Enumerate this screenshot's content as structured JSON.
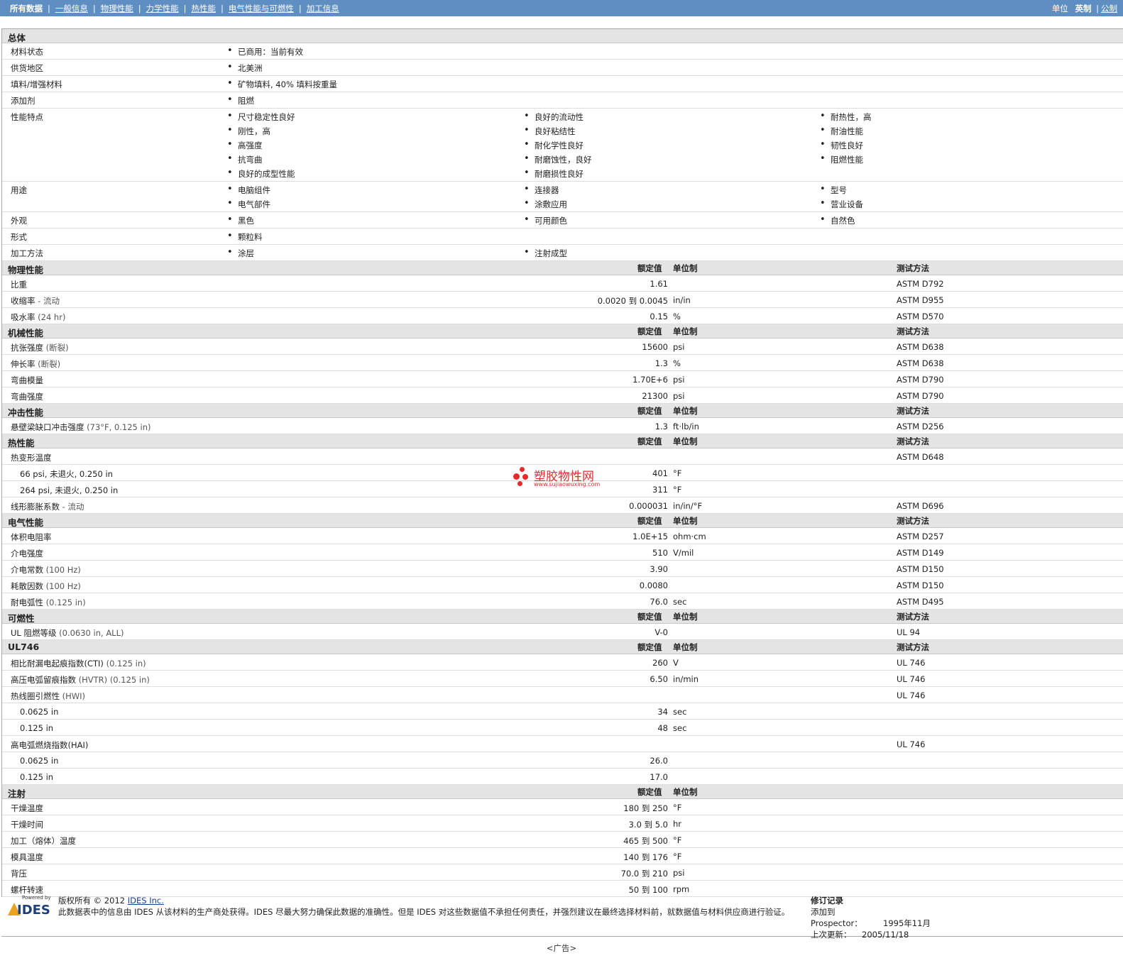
{
  "topbar": {
    "nav": [
      "所有数据",
      "一般信息",
      "物理性能",
      "力学性能",
      "热性能",
      "电气性能与可燃性",
      "加工信息"
    ],
    "units_label": "单位",
    "units_active": "英制",
    "units_other": "公制"
  },
  "general": {
    "title": "总体",
    "rows": [
      {
        "label": "材料状态",
        "cols": [
          [
            "已商用：当前有效"
          ]
        ]
      },
      {
        "label": "供货地区",
        "cols": [
          [
            "北美洲"
          ]
        ]
      },
      {
        "label": "填料/增强材料",
        "cols": [
          [
            "矿物填料, 40% 填料按重量"
          ]
        ]
      },
      {
        "label": "添加剂",
        "cols": [
          [
            "阻燃"
          ]
        ]
      },
      {
        "label": "性能特点",
        "cols": [
          [
            "尺寸稳定性良好",
            "刚性，高",
            "高强度",
            "抗弯曲",
            "良好的成型性能"
          ],
          [
            "良好的流动性",
            "良好粘结性",
            "耐化学性良好",
            "耐磨蚀性，良好",
            "耐磨损性良好"
          ],
          [
            "耐热性，高",
            "耐油性能",
            "韧性良好",
            "阻燃性能"
          ]
        ]
      },
      {
        "label": "用途",
        "cols": [
          [
            "电脑组件",
            "电气部件"
          ],
          [
            "连接器",
            "涂敷应用"
          ],
          [
            "型号",
            "营业设备"
          ]
        ]
      },
      {
        "label": "外观",
        "cols": [
          [
            "黑色"
          ],
          [
            "可用颜色"
          ],
          [
            "自然色"
          ]
        ]
      },
      {
        "label": "形式",
        "cols": [
          [
            "颗粒料"
          ]
        ]
      },
      {
        "label": "加工方法",
        "cols": [
          [
            "涂层"
          ],
          [
            "注射成型"
          ]
        ]
      }
    ]
  },
  "headers": {
    "nominal": "额定值",
    "unit": "单位制",
    "test": "测试方法"
  },
  "sections": [
    {
      "title": "物理性能",
      "test_header": true,
      "rows": [
        {
          "label": "比重",
          "value": "1.61",
          "unit": "",
          "test": "ASTM D792"
        },
        {
          "label": "收缩率",
          "cond": " - 流动",
          "value": "0.0020 到 0.0045",
          "unit": "in/in",
          "test": "ASTM D955"
        },
        {
          "label": "吸水率",
          "cond": " (24 hr)",
          "value": "0.15",
          "unit": "%",
          "test": "ASTM D570"
        }
      ]
    },
    {
      "title": "机械性能",
      "test_header": true,
      "rows": [
        {
          "label": "抗张强度",
          "cond": " (断裂)",
          "value": "15600",
          "unit": "psi",
          "test": "ASTM D638"
        },
        {
          "label": "伸长率",
          "cond": " (断裂)",
          "value": "1.3",
          "unit": "%",
          "test": "ASTM D638"
        },
        {
          "label": "弯曲模量",
          "value": "1.70E+6",
          "unit": "psi",
          "test": "ASTM D790"
        },
        {
          "label": "弯曲强度",
          "value": "21300",
          "unit": "psi",
          "test": "ASTM D790"
        }
      ]
    },
    {
      "title": "冲击性能",
      "test_header": true,
      "rows": [
        {
          "label": "悬壁梁缺口冲击强度",
          "cond": " (73°F, 0.125 in)",
          "value": "1.3",
          "unit": "ft·lb/in",
          "test": "ASTM D256"
        }
      ]
    },
    {
      "title": "热性能",
      "test_header": true,
      "rows": [
        {
          "label": "热变形温度",
          "value": "",
          "unit": "",
          "test": "ASTM D648"
        },
        {
          "label": "66 psi, 未退火, 0.250 in",
          "indent": true,
          "value": "401",
          "unit": "°F",
          "test": ""
        },
        {
          "label": "264 psi, 未退火, 0.250 in",
          "indent": true,
          "value": "311",
          "unit": "°F",
          "test": ""
        },
        {
          "label": "线形膨胀系数",
          "cond": " - 流动",
          "value": "0.000031",
          "unit": "in/in/°F",
          "test": "ASTM D696"
        }
      ]
    },
    {
      "title": "电气性能",
      "test_header": true,
      "rows": [
        {
          "label": "体积电阻率",
          "value": "1.0E+15",
          "unit": "ohm·cm",
          "test": "ASTM D257"
        },
        {
          "label": "介电强度",
          "value": "510",
          "unit": "V/mil",
          "test": "ASTM D149"
        },
        {
          "label": "介电常数",
          "cond": " (100 Hz)",
          "value": "3.90",
          "unit": "",
          "test": "ASTM D150"
        },
        {
          "label": "耗散因数",
          "cond": " (100 Hz)",
          "value": "0.0080",
          "unit": "",
          "test": "ASTM D150"
        },
        {
          "label": "耐电弧性",
          "cond": " (0.125 in)",
          "value": "76.0",
          "unit": "sec",
          "test": "ASTM D495"
        }
      ]
    },
    {
      "title": "可燃性",
      "test_header": true,
      "rows": [
        {
          "label": "UL 阻燃等级",
          "cond": " (0.0630 in, ALL)",
          "value": "V-0",
          "unit": "",
          "test": "UL 94"
        }
      ]
    },
    {
      "title": "UL746",
      "test_header": true,
      "rows": [
        {
          "label": "相比耐漏电起痕指数(CTI)",
          "cond": " (0.125 in)",
          "value": "260",
          "unit": "V",
          "test": "UL 746"
        },
        {
          "label": "高压电弧留痕指数",
          "cond": " (HVTR) (0.125 in)",
          "value": "6.50",
          "unit": "in/min",
          "test": "UL 746"
        },
        {
          "label": "热线圈引燃性",
          "cond": " (HWI)",
          "value": "",
          "unit": "",
          "test": "UL 746"
        },
        {
          "label": "0.0625 in",
          "indent": true,
          "value": "34",
          "unit": "sec",
          "test": ""
        },
        {
          "label": "0.125 in",
          "indent": true,
          "value": "48",
          "unit": "sec",
          "test": ""
        },
        {
          "label": "高电弧燃烧指数(HAI)",
          "value": "",
          "unit": "",
          "test": "UL 746"
        },
        {
          "label": "0.0625 in",
          "indent": true,
          "value": "26.0",
          "unit": "",
          "test": ""
        },
        {
          "label": "0.125 in",
          "indent": true,
          "value": "17.0",
          "unit": "",
          "test": ""
        }
      ]
    },
    {
      "title": "注射",
      "test_header": false,
      "rows": [
        {
          "label": "干燥温度",
          "value": "180 到 250",
          "unit": "°F",
          "test": ""
        },
        {
          "label": "干燥时间",
          "value": "3.0 到 5.0",
          "unit": "hr",
          "test": ""
        },
        {
          "label": "加工（熔体）温度",
          "value": "465 到 500",
          "unit": "°F",
          "test": ""
        },
        {
          "label": "模具温度",
          "value": "140 到 176",
          "unit": "°F",
          "test": ""
        },
        {
          "label": "背压",
          "value": "70.0 到 210",
          "unit": "psi",
          "test": ""
        },
        {
          "label": "螺杆转速",
          "value": "50 到 100",
          "unit": "rpm",
          "test": ""
        }
      ]
    }
  ],
  "watermark": {
    "cn": "塑胶物性网",
    "en": "www.sujiaowuxing.com"
  },
  "footer": {
    "logo_powered": "Powered by",
    "logo_text": "IDES",
    "copyright": "版权所有 © 2012",
    "copyright_link": "IDES Inc.",
    "disclaimer": "此数据表中的信息由 IDES 从该材料的生产商处获得。IDES 尽最大努力确保此数据的准确性。但是 IDES 对这些数据值不承担任何责任，并强烈建议在最终选择材料前，就数据值与材料供应商进行验证。",
    "revision_title": "修订记录",
    "added_label": "添加到 Prospector：",
    "added_value": "1995年11月",
    "updated_label": "上次更新：",
    "updated_value": "2005/11/18"
  },
  "ad": "<广告>"
}
